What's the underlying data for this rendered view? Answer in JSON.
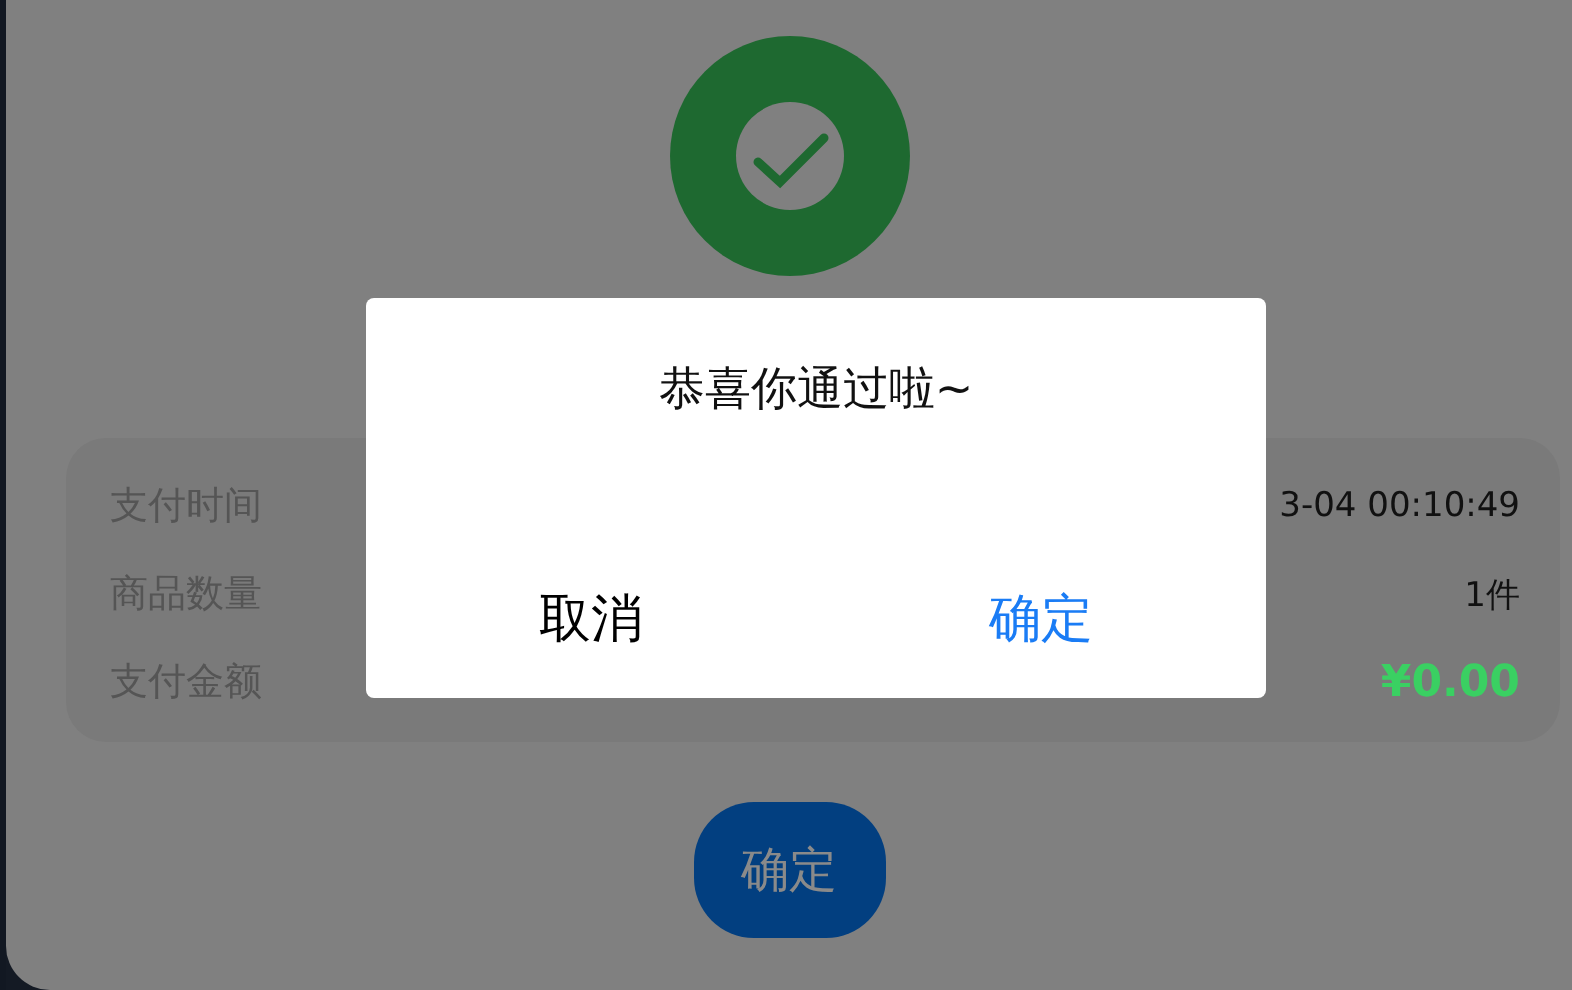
{
  "page": {
    "details": [
      {
        "label": "支付时间",
        "value": "3-04 00:10:49",
        "kind": "text"
      },
      {
        "label": "商品数量",
        "value": "1件",
        "kind": "text"
      },
      {
        "label": "支付金额",
        "value": "¥0.00",
        "kind": "amount"
      }
    ],
    "confirm_button": "确定"
  },
  "dialog": {
    "title": "恭喜你通过啦~",
    "buttons": [
      {
        "label": "取消",
        "kind": "cancel"
      },
      {
        "label": "确定",
        "kind": "confirm"
      }
    ]
  }
}
